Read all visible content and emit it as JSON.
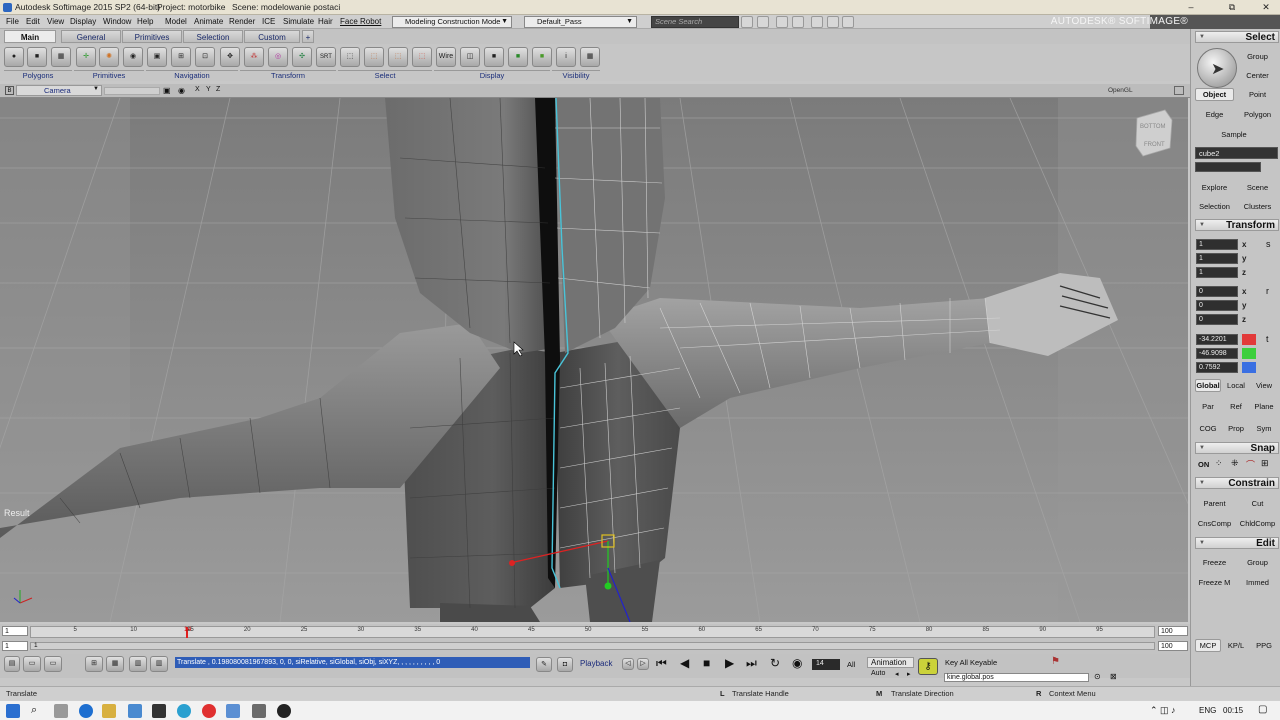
{
  "window": {
    "title": "Autodesk Softimage 2015 SP2 (64-bit)",
    "project": "Project: motorbike",
    "scene": "Scene: modelowanie postaci",
    "controls": [
      "–",
      "⧉",
      "✕"
    ]
  },
  "menubar": {
    "items": [
      "File",
      "Edit",
      "View",
      "Display",
      "Window",
      "Help",
      "Model",
      "Animate",
      "Render",
      "ICE",
      "Simulate",
      "Hair",
      "Face Robot"
    ],
    "mode": "Modeling Construction Mode",
    "pass": "Default_Pass",
    "search_placeholder": "Scene Search",
    "brand": "AUTODESK® SOFTIMAGE®"
  },
  "toolbar": {
    "tabs": [
      "Main",
      "General",
      "Primitives",
      "Selection",
      "Custom"
    ],
    "active_tab": "Main",
    "tools": [
      "Wire"
    ],
    "groups": [
      "Polygons",
      "Primitives",
      "Navigation",
      "Transform",
      "Select",
      "Display",
      "Visibility"
    ]
  },
  "viewport": {
    "camera": "Camera",
    "axes": [
      "X",
      "Y",
      "Z"
    ],
    "renderer": "OpenGL",
    "result": "Result",
    "navcube": [
      "BOTTOM",
      "FRONT"
    ]
  },
  "timeline": {
    "start": "1",
    "range_start": "1",
    "current": "14",
    "ticks": [
      "5",
      "10",
      "15",
      "20",
      "25",
      "30",
      "35",
      "40",
      "45",
      "50",
      "55",
      "60",
      "65",
      "70",
      "75",
      "80",
      "85",
      "90",
      "95"
    ],
    "end": "100",
    "range_end": "100",
    "frame_field": "14",
    "all": "All"
  },
  "playback": {
    "label": "Playback",
    "animation": "Animation",
    "auto": "Auto",
    "keyable": "Key All Keyable",
    "param": "kine.global.pos",
    "command": "Translate , 0.198080081967893, 0, 0, siRelative, siGlobal, siObj, siXYZ, , , , , , , , , , 0"
  },
  "statusbar": {
    "left": "Translate",
    "l": "L",
    "l_text": "Translate Handle",
    "m": "M",
    "m_text": "Translate Direction",
    "r": "R",
    "r_text": "Context Menu"
  },
  "rightpanel": {
    "select_header": "Select",
    "group": "Group",
    "center": "Center",
    "modes": [
      "Object",
      "Point",
      "Edge",
      "Polygon"
    ],
    "active_mode": "Object",
    "sample": "Sample",
    "object_name": "cube2",
    "explore": [
      "Explore",
      "Scene",
      "Selection",
      "Clusters"
    ],
    "transform_header": "Transform",
    "scale": [
      "1",
      "1",
      "1"
    ],
    "rotate": [
      "0",
      "0",
      "0"
    ],
    "translate": [
      "-34.2201",
      "-46.9098",
      "0.7592"
    ],
    "axis_labels": [
      "x",
      "y",
      "z"
    ],
    "ref": [
      "Global",
      "Local",
      "View",
      "Par",
      "Ref",
      "Plane",
      "COG",
      "Prop",
      "Sym"
    ],
    "snap_header": "Snap",
    "snap_on": "ON",
    "constrain_header": "Constrain",
    "constrain": [
      "Parent",
      "Cut",
      "CnsComp",
      "ChldComp"
    ],
    "edit_header": "Edit",
    "edit": [
      "Freeze",
      "Group",
      "Freeze M",
      "Immed"
    ],
    "bottom": [
      "MCP",
      "KP/L",
      "PPG"
    ],
    "colors": {
      "x": "#e23a3a",
      "y": "#3ccf3c",
      "z": "#3a6fe2"
    }
  },
  "taskbar": {
    "time": "00:15",
    "lang": "ENG"
  }
}
